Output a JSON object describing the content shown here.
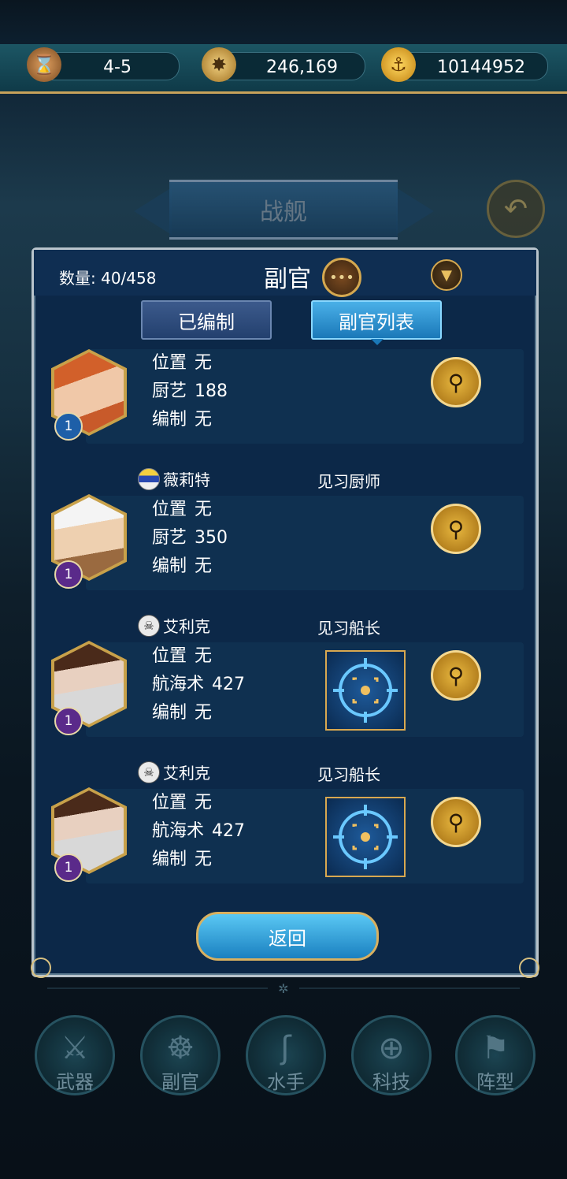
{
  "top_bar": {
    "stage": "4-5",
    "compass_value": "246,169",
    "anchor_gold": "10144952"
  },
  "background": {
    "banner_title": "战舰"
  },
  "modal": {
    "count": "数量: 40/458",
    "title": "副官",
    "tabs": [
      {
        "label": "已编制",
        "active": false
      },
      {
        "label": "副官列表",
        "active": true
      }
    ],
    "officers": [
      {
        "name": "",
        "rank": "",
        "badge": "",
        "level": "1",
        "level_color": "blue",
        "stats": [
          {
            "k": "位置",
            "v": "无"
          },
          {
            "k": "厨艺",
            "v": "188"
          },
          {
            "k": "编制",
            "v": "无"
          }
        ],
        "target": false
      },
      {
        "name": "薇莉特",
        "rank": "见习厨师",
        "badge": "flag-icon",
        "level": "1",
        "level_color": "purple",
        "stats": [
          {
            "k": "位置",
            "v": "无"
          },
          {
            "k": "厨艺",
            "v": "350"
          },
          {
            "k": "编制",
            "v": "无"
          }
        ],
        "target": false
      },
      {
        "name": "艾利克",
        "rank": "见习船长",
        "badge": "skull-icon",
        "level": "1",
        "level_color": "purple",
        "stats": [
          {
            "k": "位置",
            "v": "无"
          },
          {
            "k": "航海术",
            "v": "427"
          },
          {
            "k": "编制",
            "v": "无"
          }
        ],
        "target": true
      },
      {
        "name": "艾利克",
        "rank": "见习船长",
        "badge": "skull-icon",
        "level": "1",
        "level_color": "purple",
        "stats": [
          {
            "k": "位置",
            "v": "无"
          },
          {
            "k": "航海术",
            "v": "427"
          },
          {
            "k": "编制",
            "v": "无"
          }
        ],
        "target": true
      }
    ],
    "return_label": "返回"
  },
  "bottom_nav": [
    {
      "label": "武器",
      "icon": "weapon-icon"
    },
    {
      "label": "副官",
      "icon": "ship-wheel-icon"
    },
    {
      "label": "水手",
      "icon": "hook-icon"
    },
    {
      "label": "科技",
      "icon": "compass-icon"
    },
    {
      "label": "阵型",
      "icon": "flag-icon"
    }
  ],
  "colors": {
    "accent_gold": "#d4a850",
    "tab_active": "#2a90d0",
    "modal_bg": "#0c2848"
  }
}
